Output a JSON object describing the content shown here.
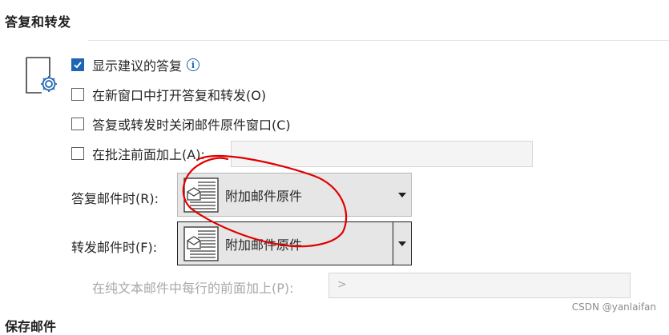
{
  "section": {
    "title": "答复和转发"
  },
  "options": {
    "show_suggested": {
      "label": "显示建议的答复",
      "checked": true
    },
    "new_window": {
      "label": "在新窗口中打开答复和转发(O)",
      "checked": false
    },
    "close_original": {
      "label": "答复或转发时关闭邮件原件窗口(C)",
      "checked": false
    },
    "prefix_comments": {
      "label": "在批注前面加上(A):",
      "checked": false,
      "value": ""
    }
  },
  "reply": {
    "label": "答复邮件时(R):",
    "value": "附加邮件原件"
  },
  "forward": {
    "label": "转发邮件时(F):",
    "value": "附加邮件原件"
  },
  "plaintext_prefix": {
    "label": "在纯文本邮件中每行的前面加上(P):",
    "value": ">"
  },
  "watermark": "CSDN @yanlaifan",
  "next_section": {
    "title": "保存邮件"
  },
  "icons": {
    "info": "info-icon",
    "gear_doc": "document-gear-icon",
    "envelope_doc": "envelope-doc-icon"
  },
  "colors": {
    "accent": "#1e66b3",
    "annotation": "#e00000"
  }
}
